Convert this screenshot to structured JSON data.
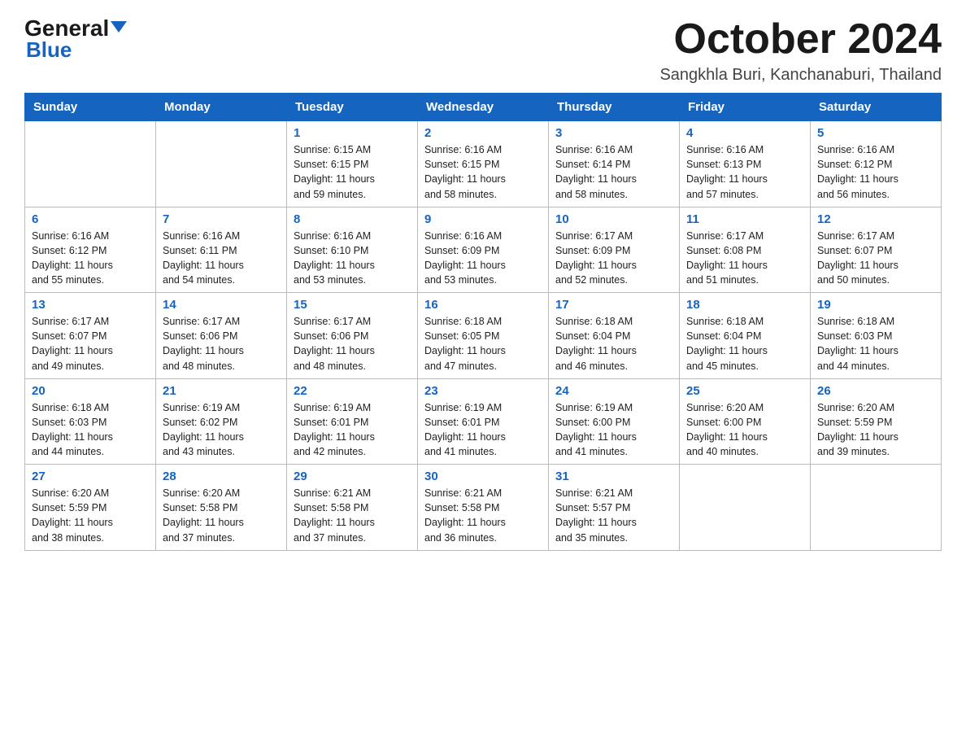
{
  "header": {
    "logo_general": "General",
    "logo_blue": "Blue",
    "month_title": "October 2024",
    "location": "Sangkhla Buri, Kanchanaburi, Thailand"
  },
  "weekdays": [
    "Sunday",
    "Monday",
    "Tuesday",
    "Wednesday",
    "Thursday",
    "Friday",
    "Saturday"
  ],
  "weeks": [
    [
      {
        "day": "",
        "info": ""
      },
      {
        "day": "",
        "info": ""
      },
      {
        "day": "1",
        "info": "Sunrise: 6:15 AM\nSunset: 6:15 PM\nDaylight: 11 hours\nand 59 minutes."
      },
      {
        "day": "2",
        "info": "Sunrise: 6:16 AM\nSunset: 6:15 PM\nDaylight: 11 hours\nand 58 minutes."
      },
      {
        "day": "3",
        "info": "Sunrise: 6:16 AM\nSunset: 6:14 PM\nDaylight: 11 hours\nand 58 minutes."
      },
      {
        "day": "4",
        "info": "Sunrise: 6:16 AM\nSunset: 6:13 PM\nDaylight: 11 hours\nand 57 minutes."
      },
      {
        "day": "5",
        "info": "Sunrise: 6:16 AM\nSunset: 6:12 PM\nDaylight: 11 hours\nand 56 minutes."
      }
    ],
    [
      {
        "day": "6",
        "info": "Sunrise: 6:16 AM\nSunset: 6:12 PM\nDaylight: 11 hours\nand 55 minutes."
      },
      {
        "day": "7",
        "info": "Sunrise: 6:16 AM\nSunset: 6:11 PM\nDaylight: 11 hours\nand 54 minutes."
      },
      {
        "day": "8",
        "info": "Sunrise: 6:16 AM\nSunset: 6:10 PM\nDaylight: 11 hours\nand 53 minutes."
      },
      {
        "day": "9",
        "info": "Sunrise: 6:16 AM\nSunset: 6:09 PM\nDaylight: 11 hours\nand 53 minutes."
      },
      {
        "day": "10",
        "info": "Sunrise: 6:17 AM\nSunset: 6:09 PM\nDaylight: 11 hours\nand 52 minutes."
      },
      {
        "day": "11",
        "info": "Sunrise: 6:17 AM\nSunset: 6:08 PM\nDaylight: 11 hours\nand 51 minutes."
      },
      {
        "day": "12",
        "info": "Sunrise: 6:17 AM\nSunset: 6:07 PM\nDaylight: 11 hours\nand 50 minutes."
      }
    ],
    [
      {
        "day": "13",
        "info": "Sunrise: 6:17 AM\nSunset: 6:07 PM\nDaylight: 11 hours\nand 49 minutes."
      },
      {
        "day": "14",
        "info": "Sunrise: 6:17 AM\nSunset: 6:06 PM\nDaylight: 11 hours\nand 48 minutes."
      },
      {
        "day": "15",
        "info": "Sunrise: 6:17 AM\nSunset: 6:06 PM\nDaylight: 11 hours\nand 48 minutes."
      },
      {
        "day": "16",
        "info": "Sunrise: 6:18 AM\nSunset: 6:05 PM\nDaylight: 11 hours\nand 47 minutes."
      },
      {
        "day": "17",
        "info": "Sunrise: 6:18 AM\nSunset: 6:04 PM\nDaylight: 11 hours\nand 46 minutes."
      },
      {
        "day": "18",
        "info": "Sunrise: 6:18 AM\nSunset: 6:04 PM\nDaylight: 11 hours\nand 45 minutes."
      },
      {
        "day": "19",
        "info": "Sunrise: 6:18 AM\nSunset: 6:03 PM\nDaylight: 11 hours\nand 44 minutes."
      }
    ],
    [
      {
        "day": "20",
        "info": "Sunrise: 6:18 AM\nSunset: 6:03 PM\nDaylight: 11 hours\nand 44 minutes."
      },
      {
        "day": "21",
        "info": "Sunrise: 6:19 AM\nSunset: 6:02 PM\nDaylight: 11 hours\nand 43 minutes."
      },
      {
        "day": "22",
        "info": "Sunrise: 6:19 AM\nSunset: 6:01 PM\nDaylight: 11 hours\nand 42 minutes."
      },
      {
        "day": "23",
        "info": "Sunrise: 6:19 AM\nSunset: 6:01 PM\nDaylight: 11 hours\nand 41 minutes."
      },
      {
        "day": "24",
        "info": "Sunrise: 6:19 AM\nSunset: 6:00 PM\nDaylight: 11 hours\nand 41 minutes."
      },
      {
        "day": "25",
        "info": "Sunrise: 6:20 AM\nSunset: 6:00 PM\nDaylight: 11 hours\nand 40 minutes."
      },
      {
        "day": "26",
        "info": "Sunrise: 6:20 AM\nSunset: 5:59 PM\nDaylight: 11 hours\nand 39 minutes."
      }
    ],
    [
      {
        "day": "27",
        "info": "Sunrise: 6:20 AM\nSunset: 5:59 PM\nDaylight: 11 hours\nand 38 minutes."
      },
      {
        "day": "28",
        "info": "Sunrise: 6:20 AM\nSunset: 5:58 PM\nDaylight: 11 hours\nand 37 minutes."
      },
      {
        "day": "29",
        "info": "Sunrise: 6:21 AM\nSunset: 5:58 PM\nDaylight: 11 hours\nand 37 minutes."
      },
      {
        "day": "30",
        "info": "Sunrise: 6:21 AM\nSunset: 5:58 PM\nDaylight: 11 hours\nand 36 minutes."
      },
      {
        "day": "31",
        "info": "Sunrise: 6:21 AM\nSunset: 5:57 PM\nDaylight: 11 hours\nand 35 minutes."
      },
      {
        "day": "",
        "info": ""
      },
      {
        "day": "",
        "info": ""
      }
    ]
  ]
}
